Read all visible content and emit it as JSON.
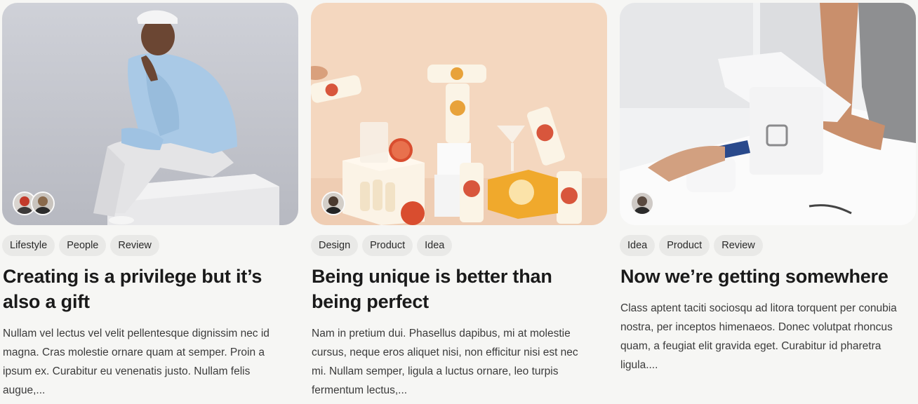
{
  "cards": [
    {
      "tags": [
        "Lifestyle",
        "People",
        "Review"
      ],
      "title": "Creating is a privilege but it’s also a gift",
      "excerpt": "Nullam vel lectus vel velit pellentesque dignissim nec id magna. Cras molestie ornare quam at semper. Proin a ipsum ex. Curabitur eu venenatis justo. Nullam felis augue,..."
    },
    {
      "tags": [
        "Design",
        "Product",
        "Idea"
      ],
      "title": "Being unique is better than being perfect",
      "excerpt": "Nam in pretium dui. Phasellus dapibus, mi at molestie cursus, neque eros aliquet nisi, non efficitur nisi est nec mi. Nullam semper, ligula a luctus ornare, leo turpis fermentum lectus,..."
    },
    {
      "tags": [
        "Idea",
        "Product",
        "Review"
      ],
      "title": "Now we’re getting somewhere",
      "excerpt": "Class aptent taciti sociosqu ad litora torquent per conubia nostra, per inceptos himenaeos. Donec volutpat rhoncus quam, a feugiat elit gravida eget. Curabitur id pharetra ligula...."
    }
  ],
  "colors": {
    "page_background": "#f6f6f4",
    "tag_background": "#e9e9e7",
    "title_text": "#1a1a1a",
    "body_text": "#3b3b3b"
  }
}
